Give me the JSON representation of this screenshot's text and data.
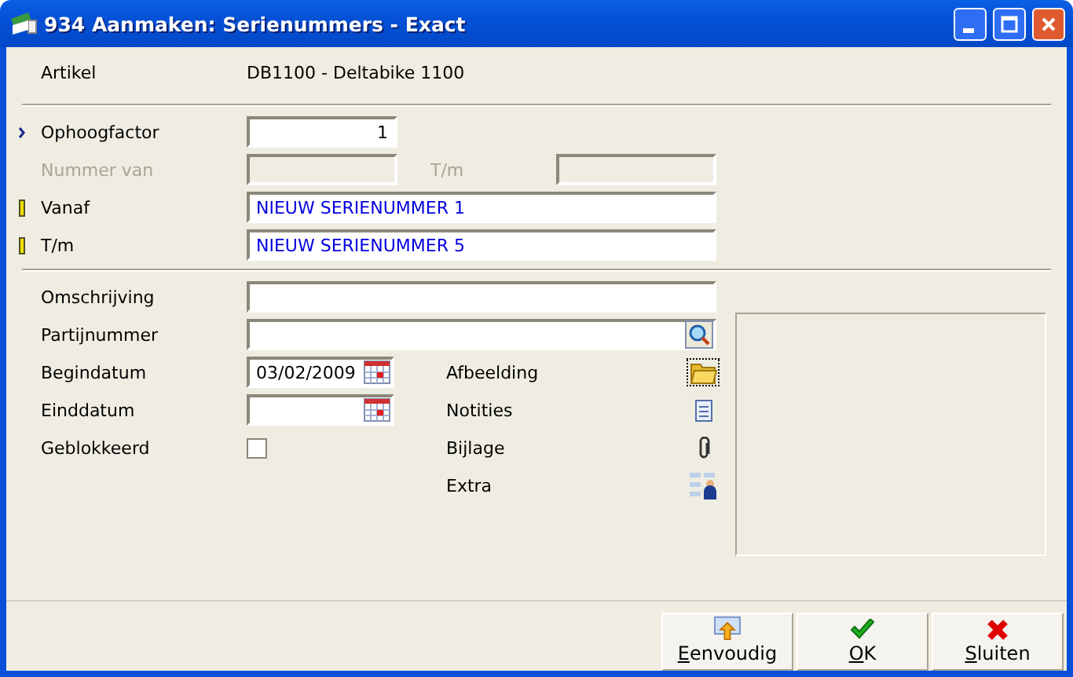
{
  "window": {
    "title": "934 Aanmaken: Serienummers - Exact"
  },
  "article": {
    "label": "Artikel",
    "value": "DB1100 - Deltabike 1100"
  },
  "range_rows": [
    {
      "kind": "number",
      "label": "Ophoogfactor",
      "value": "1",
      "focused": true,
      "required": false,
      "disabled": false
    },
    {
      "kind": "pair",
      "label": "Nummer van",
      "second_label": "T/m",
      "focused": false,
      "required": false,
      "disabled": true
    },
    {
      "kind": "text",
      "label": "Vanaf",
      "value": "NIEUW SERIENUMMER 1",
      "focused": false,
      "required": true,
      "disabled": false
    },
    {
      "kind": "text",
      "label": "T/m",
      "value": "NIEUW SERIENUMMER 5",
      "focused": false,
      "required": true,
      "disabled": false
    }
  ],
  "detail_rows": [
    {
      "kind": "text",
      "label": "Omschrijving"
    },
    {
      "kind": "lookup",
      "label": "Partijnummer"
    },
    {
      "kind": "date",
      "label": "Begindatum",
      "value": "03/02/2009"
    },
    {
      "kind": "date",
      "label": "Einddatum"
    },
    {
      "kind": "checkbox",
      "label": "Geblokkeerd",
      "checked": false
    }
  ],
  "attachments": [
    {
      "kind": "folder",
      "label": "Afbeelding",
      "focused": true
    },
    {
      "kind": "notes",
      "label": "Notities",
      "focused": false
    },
    {
      "kind": "clip",
      "label": "Bijlage",
      "focused": false
    },
    {
      "kind": "extra",
      "label": "Extra",
      "focused": false
    }
  ],
  "buttons": [
    {
      "kind": "simple",
      "label": "Eenvoudig"
    },
    {
      "kind": "ok",
      "label": "OK"
    },
    {
      "kind": "close",
      "label": "Sluiten"
    }
  ]
}
